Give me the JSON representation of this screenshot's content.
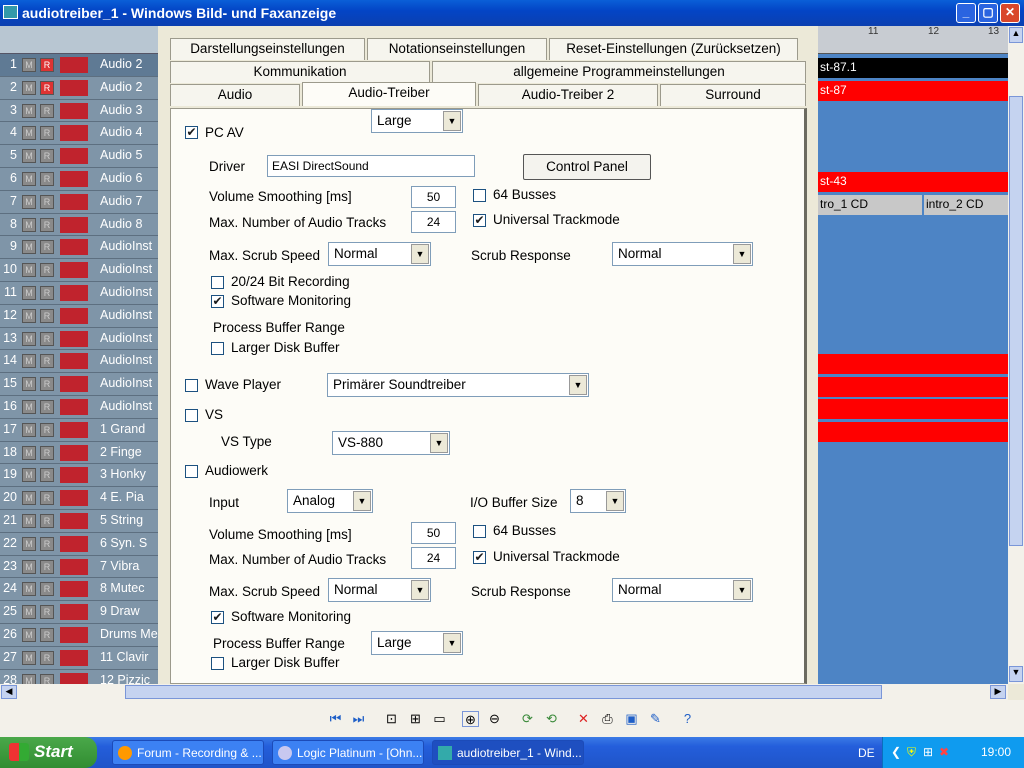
{
  "window": {
    "title": "audiotreiber_1 - Windows Bild- und Faxanzeige",
    "minimize": "_",
    "maximize": "▢",
    "close": "✕"
  },
  "tracks": [
    {
      "num": "1",
      "name": "Audio 2",
      "rec": true
    },
    {
      "num": "2",
      "name": "Audio 2",
      "rec": true
    },
    {
      "num": "3",
      "name": "Audio 3"
    },
    {
      "num": "4",
      "name": "Audio 4"
    },
    {
      "num": "5",
      "name": "Audio 5"
    },
    {
      "num": "6",
      "name": "Audio 6"
    },
    {
      "num": "7",
      "name": "Audio 7"
    },
    {
      "num": "8",
      "name": "Audio 8"
    },
    {
      "num": "9",
      "name": "AudioInst"
    },
    {
      "num": "10",
      "name": "AudioInst"
    },
    {
      "num": "11",
      "name": "AudioInst"
    },
    {
      "num": "12",
      "name": "AudioInst"
    },
    {
      "num": "13",
      "name": "AudioInst"
    },
    {
      "num": "14",
      "name": "AudioInst"
    },
    {
      "num": "15",
      "name": "AudioInst"
    },
    {
      "num": "16",
      "name": "AudioInst"
    },
    {
      "num": "17",
      "name": "1   Grand"
    },
    {
      "num": "18",
      "name": "2   Finge"
    },
    {
      "num": "19",
      "name": "3   Honky"
    },
    {
      "num": "20",
      "name": "4   E. Pia"
    },
    {
      "num": "21",
      "name": "5   String"
    },
    {
      "num": "22",
      "name": "6   Syn. S"
    },
    {
      "num": "23",
      "name": "7   Vibra"
    },
    {
      "num": "24",
      "name": "8   Mutec"
    },
    {
      "num": "25",
      "name": "9   Draw"
    },
    {
      "num": "26",
      "name": "Drums Me"
    },
    {
      "num": "27",
      "name": "11  Clavir"
    },
    {
      "num": "28",
      "name": "12  Pizzic"
    }
  ],
  "track_m": "M",
  "track_r": "R",
  "arrange": {
    "ruler_marks": [
      "11",
      "12",
      "13"
    ],
    "regions": [
      "st-87.1",
      "st-87",
      "st-43",
      "tro_1  CD",
      "intro_2  CD"
    ]
  },
  "tabs": {
    "row1": [
      "Darstellungseinstellungen",
      "Notationseinstellungen",
      "Reset-Einstellungen (Zurücksetzen)"
    ],
    "row2": [
      "Kommunikation",
      "allgemeine Programmeinstellungen"
    ],
    "row3": [
      "Audio",
      "Audio-Treiber",
      "Audio-Treiber 2",
      "Surround"
    ]
  },
  "pcav": {
    "label": "PC AV",
    "checked": true,
    "driver_label": "Driver",
    "driver_value": "EASI DirectSound",
    "control_panel": "Control Panel",
    "vol_smooth_label": "Volume Smoothing [ms]",
    "vol_smooth": "50",
    "busses_label": "64 Busses",
    "max_tracks_label": "Max. Number of Audio Tracks",
    "max_tracks": "24",
    "universal_label": "Universal Trackmode",
    "scrub_speed_label": "Max. Scrub Speed",
    "scrub_speed": "Normal",
    "scrub_resp_label": "Scrub Response",
    "scrub_resp": "Normal",
    "bit_rec_label": "20/24 Bit Recording",
    "sw_mon_label": "Software Monitoring",
    "buf_range_label": "Process Buffer Range",
    "buf_range": "Large",
    "larger_disk_label": "Larger Disk Buffer"
  },
  "wave": {
    "label": "Wave Player",
    "value": "Primärer Soundtreiber"
  },
  "vs": {
    "label": "VS",
    "type_label": "VS Type",
    "type_value": "VS-880"
  },
  "aw": {
    "label": "Audiowerk",
    "input_label": "Input",
    "input_value": "Analog",
    "io_label": "I/O Buffer Size",
    "io_value": "8",
    "vol_smooth_label": "Volume Smoothing [ms]",
    "vol_smooth": "50",
    "busses_label": "64 Busses",
    "max_tracks_label": "Max. Number of Audio Tracks",
    "max_tracks": "24",
    "universal_label": "Universal Trackmode",
    "scrub_speed_label": "Max. Scrub Speed",
    "scrub_speed": "Normal",
    "scrub_resp_label": "Scrub Response",
    "scrub_resp": "Normal",
    "sw_mon_label": "Software Monitoring",
    "buf_range_label": "Process Buffer Range",
    "buf_range": "Large",
    "larger_disk_label": "Larger Disk Buffer"
  },
  "taskbar": {
    "start": "Start",
    "tasks": [
      "Forum - Recording & ...",
      "Logic Platinum - [Ohn...",
      "audiotreiber_1 - Wind..."
    ],
    "lang": "DE",
    "clock": "19:00"
  },
  "colors": {
    "title": "#0a5fd8",
    "mixer": "#7f95a8",
    "region_red": "#ff0000",
    "taskbar": "#245edb",
    "start": "#3c9a3c"
  }
}
